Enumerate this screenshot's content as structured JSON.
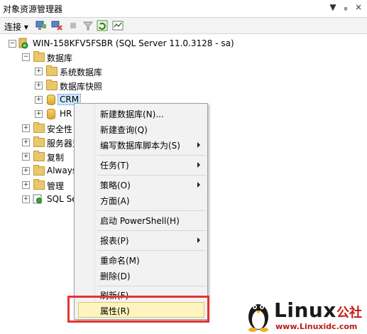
{
  "window": {
    "title": "对象资源管理器",
    "controls": [
      "▼",
      "ᵩ",
      "×"
    ]
  },
  "toolbar": {
    "connect_label": "连接"
  },
  "tree": {
    "server": "WIN-158KFV5FSBR (SQL Server 11.0.3128 - sa)",
    "databases": "数据库",
    "system_databases": "系统数据库",
    "db_snapshots": "数据库快照",
    "db_crm": "CRM",
    "db_hr": "HR",
    "security": "安全性",
    "server_objects": "服务器对",
    "replication": "复制",
    "always": "Always",
    "management": "管理",
    "sql_agent": "SQL Se"
  },
  "context_menu": {
    "items": [
      "新建数据库(N)...",
      "新建查询(Q)",
      "编写数据库脚本为(S)",
      "任务(T)",
      "策略(O)",
      "方面(A)",
      "启动 PowerShell(H)",
      "报表(P)",
      "重命名(M)",
      "删除(D)",
      "刷新(F)",
      "属性(R)"
    ]
  },
  "watermark": {
    "brand": "Linux",
    "brand_cn": "公社",
    "url": "www.Linuxidc.com"
  },
  "colors": {
    "highlight_border": "#e53333",
    "menu_hover": "#fdf4bf",
    "selection": "#cde8ff"
  }
}
